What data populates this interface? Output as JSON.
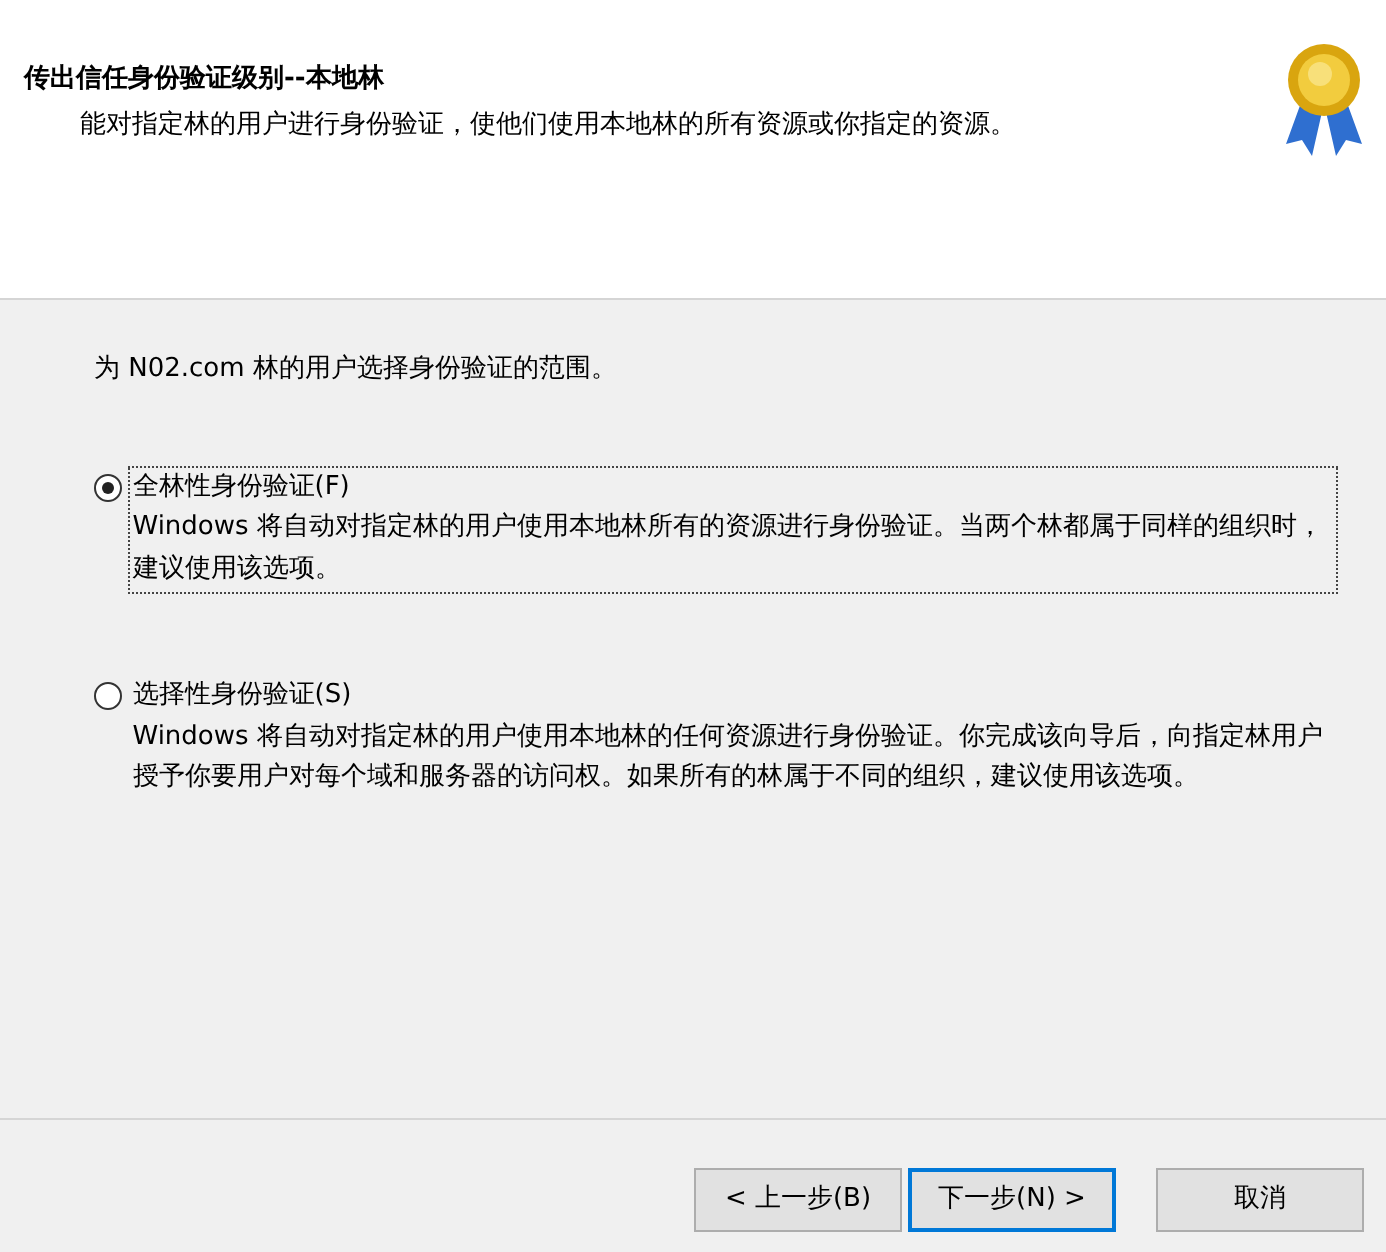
{
  "header": {
    "title": "传出信任身份验证级别--本地林",
    "subtitle": "能对指定林的用户进行身份验证，使他们使用本地林的所有资源或你指定的资源。"
  },
  "prompt": "为 N02.com 林的用户选择身份验证的范围。",
  "options": [
    {
      "label": "全林性身份验证(F)",
      "description": "Windows 将自动对指定林的用户使用本地林所有的资源进行身份验证。当两个林都属于同样的组织时，建议使用该选项。",
      "selected": true,
      "focused": true
    },
    {
      "label": "选择性身份验证(S)",
      "description": "Windows 将自动对指定林的用户使用本地林的任何资源进行身份验证。你完成该向导后，向指定林用户授予你要用户对每个域和服务器的访问权。如果所有的林属于不同的组织，建议使用该选项。",
      "selected": false,
      "focused": false
    }
  ],
  "buttons": [
    {
      "label": "< 上一步(B)",
      "default": false
    },
    {
      "label": "下一步(N) >",
      "default": true
    },
    {
      "label": "取消",
      "default": false
    }
  ]
}
